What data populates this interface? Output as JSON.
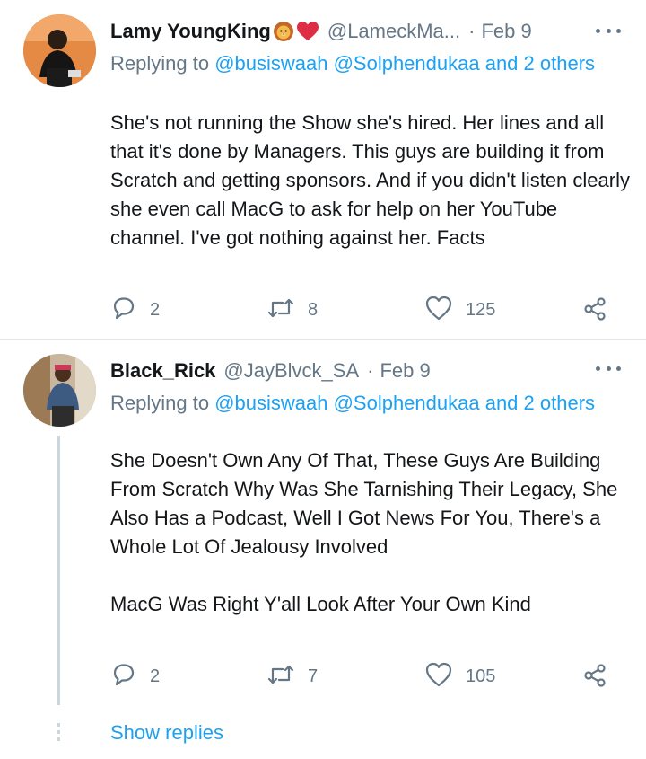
{
  "tweets": [
    {
      "display_name": "Lamy YoungKing",
      "handle": "@LameckMa...",
      "separator": "·",
      "date": "Feb 9",
      "replying_prefix": "Replying to ",
      "replying_mentions": "@busiswaah @Solphendukaa and 2 others",
      "text": "She's not running the Show she's hired. Her lines and all that it's done by Managers. This guys are building it from Scratch and getting sponsors. And if you didn't listen clearly she even call MacG to ask for help on her YouTube channel. I've got nothing against her. Facts",
      "replies": "2",
      "retweets": "8",
      "likes": "125"
    },
    {
      "display_name": "Black_Rick",
      "handle": "@JayBlvck_SA",
      "separator": "·",
      "date": "Feb 9",
      "replying_prefix": "Replying to ",
      "replying_mentions": "@busiswaah @Solphendukaa and 2 others",
      "text": "She Doesn't Own Any Of That, These Guys Are Building From Scratch Why Was She Tarnishing Their Legacy, She Also Has a Podcast, Well I Got News For You, There's a Whole Lot Of Jealousy Involved\n\nMacG Was Right Y'all Look After Your Own Kind",
      "replies": "2",
      "retweets": "7",
      "likes": "105"
    }
  ],
  "show_replies_label": "Show replies",
  "icons": {
    "emoji_1": "lion-face-icon",
    "emoji_2": "red-heart-icon",
    "more": "more-options-icon",
    "reply": "reply-icon",
    "retweet": "retweet-icon",
    "like": "heart-icon",
    "share": "share-icon"
  },
  "colors": {
    "text": "#14171a",
    "secondary": "#657786",
    "link": "#1da1f2",
    "divider": "#e1e8ed",
    "heart_emoji": "#e0245e"
  }
}
